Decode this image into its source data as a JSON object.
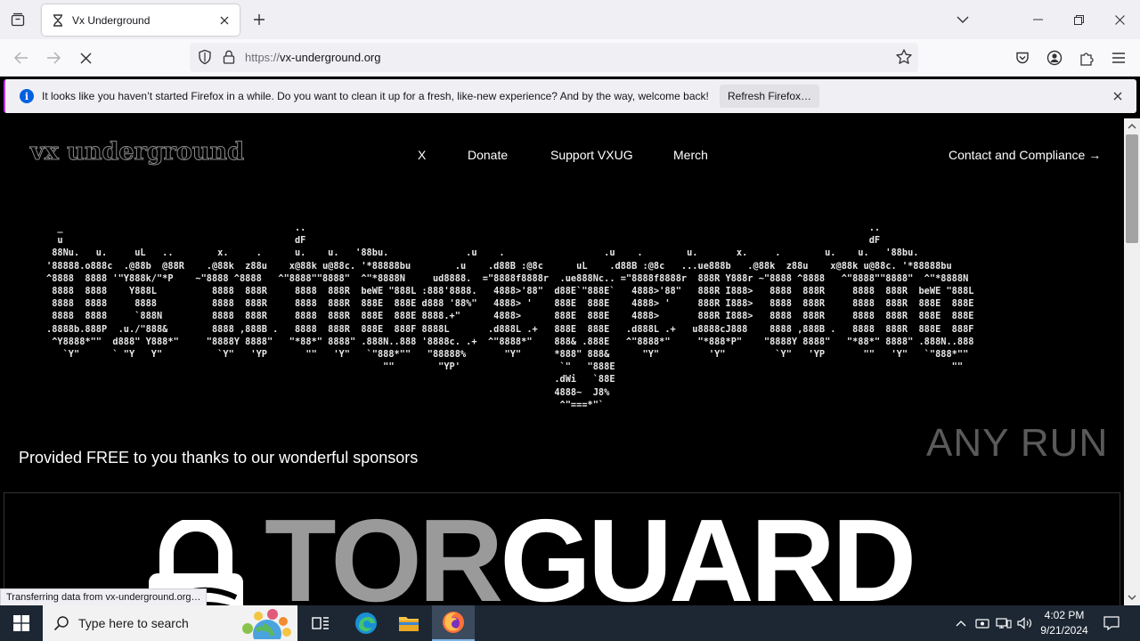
{
  "browser": {
    "tab": {
      "title": "Vx Underground"
    },
    "url": {
      "scheme": "https://",
      "host": "vx-underground.org"
    },
    "notification": {
      "text": "It looks like you haven’t started Firefox in a while. Do you want to clean it up for a fresh, like-new experience? And by the way, welcome back!",
      "button": "Refresh Firefox…"
    },
    "status": "Transferring data from vx-underground.org…"
  },
  "site": {
    "logo": "vx underground",
    "nav": [
      "X",
      "Donate",
      "Support VXUG",
      "Merch"
    ],
    "contact": "Contact and Compliance →",
    "sponsor_heading": "Provided FREE to you thanks to our wonderful sponsors",
    "sponsor_name_a": "TOR",
    "sponsor_name_b": "GUARD",
    "watermark": "ANY RUN"
  },
  "taskbar": {
    "search_placeholder": "Type here to search",
    "time": "4:02 PM",
    "date": "9/21/2024"
  },
  "colors": {
    "accent": "#0060df",
    "notif_border": "#b833e1",
    "taskbar": "#1c2733"
  }
}
